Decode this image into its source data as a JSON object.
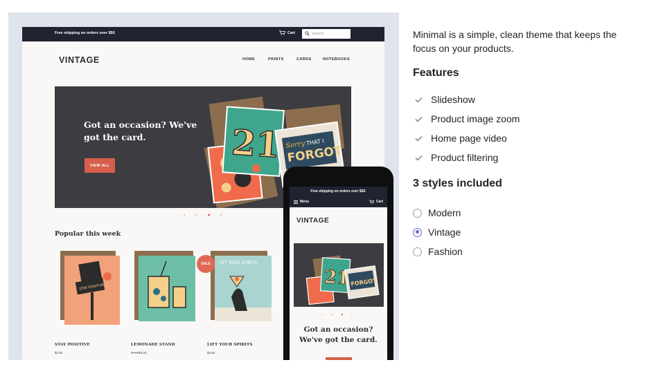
{
  "preview": {
    "announcement": "Free shipping on orders over $50",
    "cart_label": "Cart",
    "search_placeholder": "Search",
    "logo": "VINTAGE",
    "nav": [
      "HOME",
      "PRINTS",
      "CARDS",
      "NOTEBOOKS"
    ],
    "hero": {
      "heading": "Got an occasion? We've got the card.",
      "button": "VIEW ALL",
      "card_number": "21",
      "card_text_1": "Sorry",
      "card_text_2": "THAT I",
      "card_text_3": "FORGOT"
    },
    "slider_dots": "‹ ○ ● ›",
    "section_title": "Popular this week",
    "products": [
      {
        "name": "STAY POSITIVE",
        "price": "$3.50",
        "compare_price": "",
        "art_text": "STAY POSITIVE"
      },
      {
        "name": "LEMONADE STAND",
        "price": "$3.50",
        "compare_price": "$5.00",
        "art_text": ""
      },
      {
        "name": "LIFT YOUR SPIRITS",
        "price": "$3.50",
        "compare_price": "",
        "art_text": "LIFT YOUR SPIRITS"
      }
    ],
    "sale_badge": "SALE",
    "mobile": {
      "announcement": "Free shipping on orders over $50.",
      "menu_label": "Menu",
      "cart_label": "Cart",
      "logo": "VINTAGE",
      "slider_dots": "‹ ○ ● ›",
      "heading": "Got an occasion? We've got the card."
    }
  },
  "info": {
    "description": "Minimal is a simple, clean theme that keeps the focus on your products.",
    "features_title": "Features",
    "features": [
      "Slideshow",
      "Product image zoom",
      "Home page video",
      "Product filtering"
    ],
    "styles_title": "3 styles included",
    "styles": [
      "Modern",
      "Vintage",
      "Fashion"
    ],
    "selected_style": "Vintage"
  },
  "colors": {
    "accent": "#d65e4b",
    "dark_bar": "#202431",
    "radio_selected": "#5c6ac4",
    "panel_bg": "#dfe3ec"
  },
  "icons": [
    "cart-icon",
    "search-icon",
    "menu-icon",
    "check-icon"
  ]
}
